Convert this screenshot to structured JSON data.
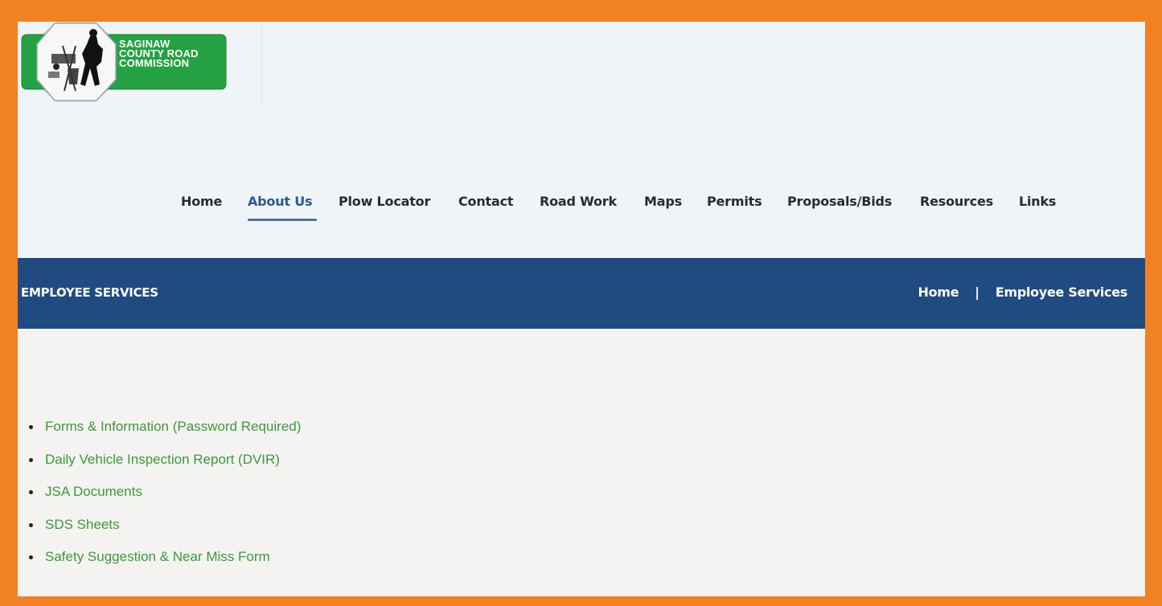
{
  "logo": {
    "lines": [
      "SAGINAW",
      "COUNTY ROAD",
      "COMMISSION"
    ]
  },
  "nav": {
    "items": [
      {
        "label": "Home"
      },
      {
        "label": "About Us"
      },
      {
        "label": "Plow Locator"
      },
      {
        "label": "Contact"
      },
      {
        "label": "Road Work"
      },
      {
        "label": "Maps"
      },
      {
        "label": "Permits"
      },
      {
        "label": "Proposals/Bids"
      },
      {
        "label": "Resources"
      },
      {
        "label": "Links"
      }
    ],
    "active": "About Us"
  },
  "title_bar": {
    "title": "EMPLOYEE SERVICES",
    "breadcrumb": {
      "home": "Home",
      "separator": "|",
      "current": "Employee Services"
    }
  },
  "links": [
    {
      "label": "Forms & Information (Password Required)"
    },
    {
      "label": "Daily Vehicle Inspection Report (DVIR)"
    },
    {
      "label": "JSA Documents"
    },
    {
      "label": "SDS Sheets"
    },
    {
      "label": "Safety Suggestion & Near Miss Form"
    }
  ],
  "colors": {
    "frame": "#f28124",
    "title_bar": "#204b80",
    "link": "#3a9a36",
    "logo_green": "#25a244",
    "nav_active": "#2a5a92"
  }
}
